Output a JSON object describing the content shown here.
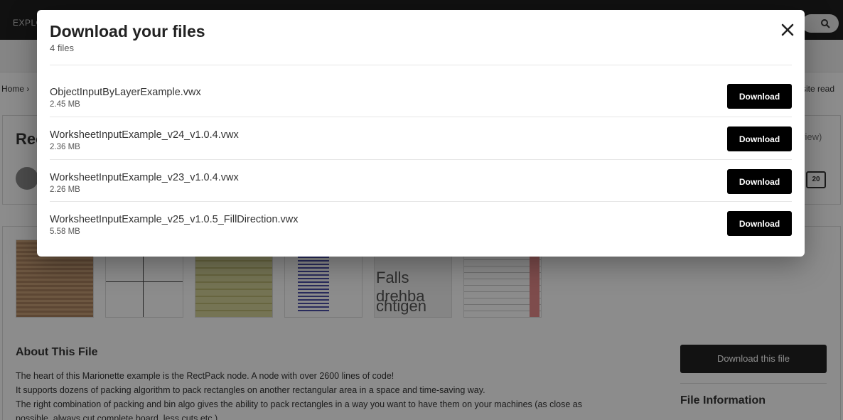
{
  "background": {
    "nav_label": "EXPLO",
    "breadcrumb": "Home  ›",
    "read_link": "site read",
    "page_title": "Rec",
    "review_text": "view)",
    "review_count": "20",
    "thumb_text_1": "Falls drehba",
    "thumb_text_2": "chtigen",
    "about_heading": "About This File",
    "about_lines": [
      "The heart of this Marionette example is the RectPack node. A node with over 2600 lines of code!",
      "It supports dozens of packing algorithm to pack rectangles on another rectangular area in a space and time-saving way.",
      "The right combination of packing and bin algo gives the ability to pack rectangles in a way you want to have them on your machines (as close as",
      "possible, always cut complete board, less cuts etc.)"
    ],
    "download_file_label": "Download this file",
    "file_info_heading": "File Information"
  },
  "modal": {
    "title": "Download your files",
    "subtitle": "4 files",
    "close_icon": "close-icon",
    "files": [
      {
        "name": "ObjectInputByLayerExample.vwx",
        "size": "2.45 MB",
        "button_label": "Download"
      },
      {
        "name": "WorksheetInputExample_v24_v1.0.4.vwx",
        "size": "2.36 MB",
        "button_label": "Download"
      },
      {
        "name": "WorksheetInputExample_v23_v1.0.4.vwx",
        "size": "2.26 MB",
        "button_label": "Download"
      },
      {
        "name": "WorksheetInputExample_v25_v1.0.5_FillDirection.vwx",
        "size": "5.58 MB",
        "button_label": "Download"
      }
    ]
  },
  "colors": {
    "overlay": "#000000",
    "button_bg": "#000000",
    "button_text": "#ffffff"
  }
}
